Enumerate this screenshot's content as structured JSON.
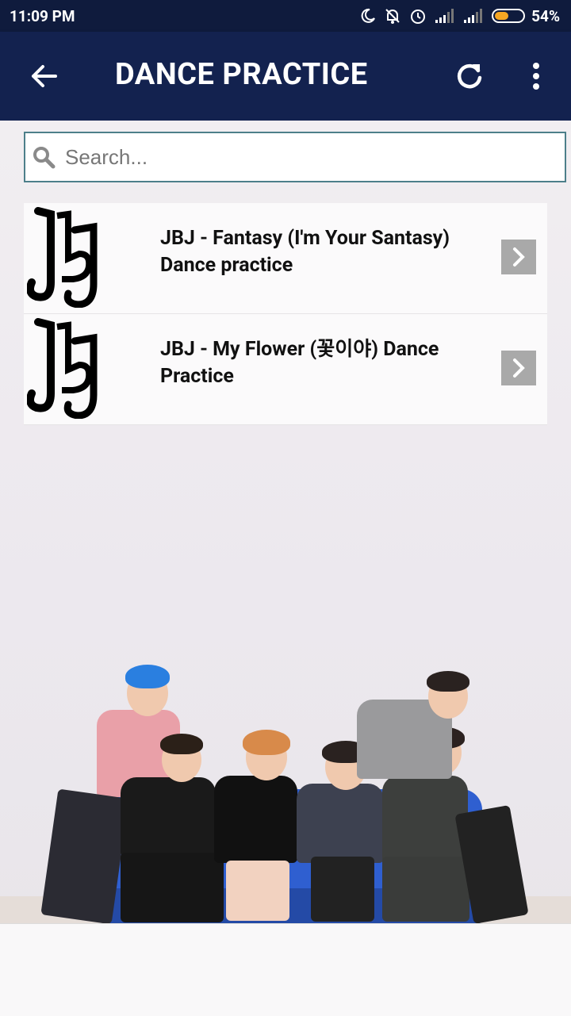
{
  "status": {
    "time": "11:09 PM",
    "battery_percent": "54%",
    "battery_level": 0.54,
    "icons": [
      "moon-icon",
      "bell-off-icon",
      "alarm-icon",
      "signal-icon",
      "signal-icon",
      "battery-icon"
    ]
  },
  "appbar": {
    "title": "DANCE PRACTICE",
    "back_icon": "arrow-left-icon",
    "refresh_icon": "refresh-icon",
    "more_icon": "more-vertical-icon"
  },
  "search": {
    "placeholder": "Search...",
    "value": ""
  },
  "videos": [
    {
      "title": "JBJ - Fantasy (I'm Your Santasy) Dance practice",
      "thumb": "jbj-logo"
    },
    {
      "title": "JBJ - My Flower (꽃이야) Dance Practice",
      "thumb": "jbj-logo"
    }
  ],
  "colors": {
    "status_bar": "#0f1b3d",
    "app_bar": "#13224f",
    "search_border": "#4d7f8a",
    "arrow_button": "#a9a9a9"
  }
}
